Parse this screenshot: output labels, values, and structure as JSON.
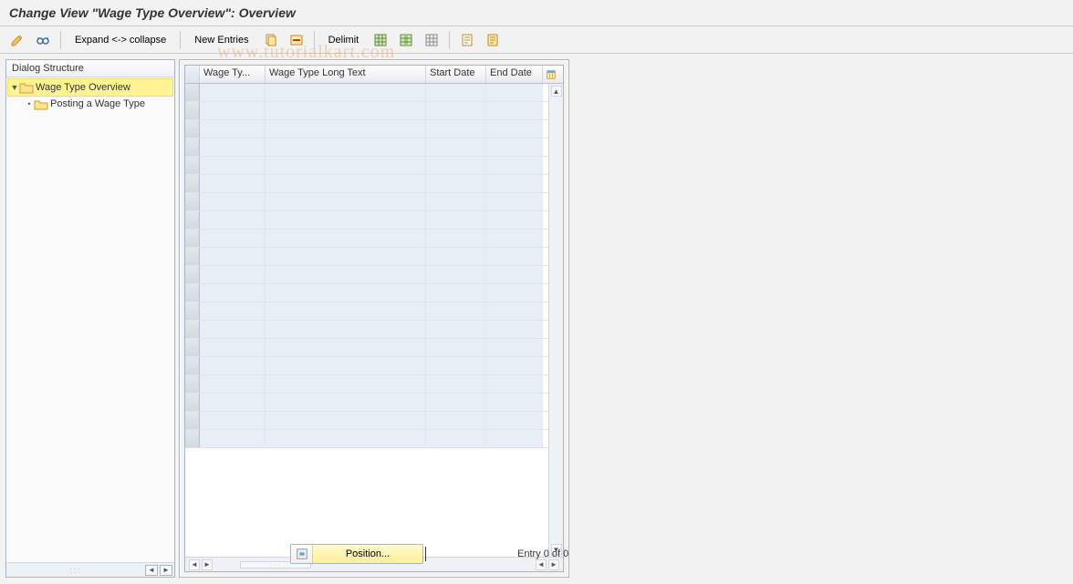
{
  "title": "Change View \"Wage Type Overview\": Overview",
  "toolbar": {
    "expand_collapse": "Expand <-> collapse",
    "new_entries": "New Entries",
    "delimit": "Delimit"
  },
  "sidebar": {
    "header": "Dialog Structure",
    "items": [
      {
        "label": "Wage Type Overview"
      },
      {
        "label": "Posting a Wage Type"
      }
    ]
  },
  "grid": {
    "columns": {
      "c1": "Wage Ty...",
      "c2": "Wage Type Long Text",
      "c3": "Start Date",
      "c4": "End Date"
    }
  },
  "footer": {
    "position_label": "Position...",
    "entry_text": "Entry 0 of 0"
  },
  "watermark": "www.tutorialkart.com"
}
